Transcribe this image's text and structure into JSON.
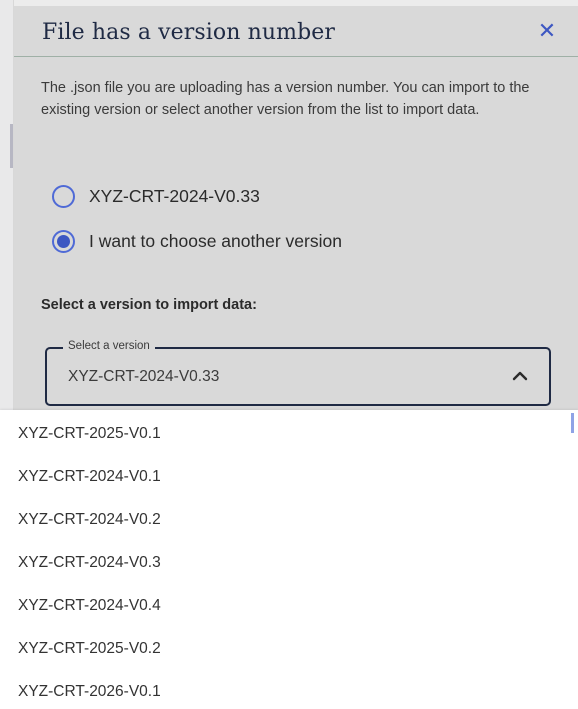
{
  "dialog": {
    "title": "File has a version number",
    "close_icon": "close-icon",
    "close_glyph": "✕",
    "description": "The .json file you are uploading has a version number. You can import to the existing version or select another version from the list to import data."
  },
  "radios": [
    {
      "label": "XYZ-CRT-2024-V0.33",
      "checked": false
    },
    {
      "label": "I want to choose another version",
      "checked": true
    }
  ],
  "section_label": "Select a version to import data:",
  "select": {
    "legend": "Select a version",
    "value": "XYZ-CRT-2024-V0.33",
    "icon": "chevron-up-icon",
    "expanded": true
  },
  "dropdown_options": [
    "XYZ-CRT-2025-V0.1",
    "XYZ-CRT-2024-V0.1",
    "XYZ-CRT-2024-V0.2",
    "XYZ-CRT-2024-V0.3",
    "XYZ-CRT-2024-V0.4",
    "XYZ-CRT-2025-V0.2",
    "XYZ-CRT-2026-V0.1"
  ],
  "colors": {
    "accent": "#3d57c2",
    "dialog_bg": "#d9d9d9",
    "title": "#1f2a44"
  }
}
